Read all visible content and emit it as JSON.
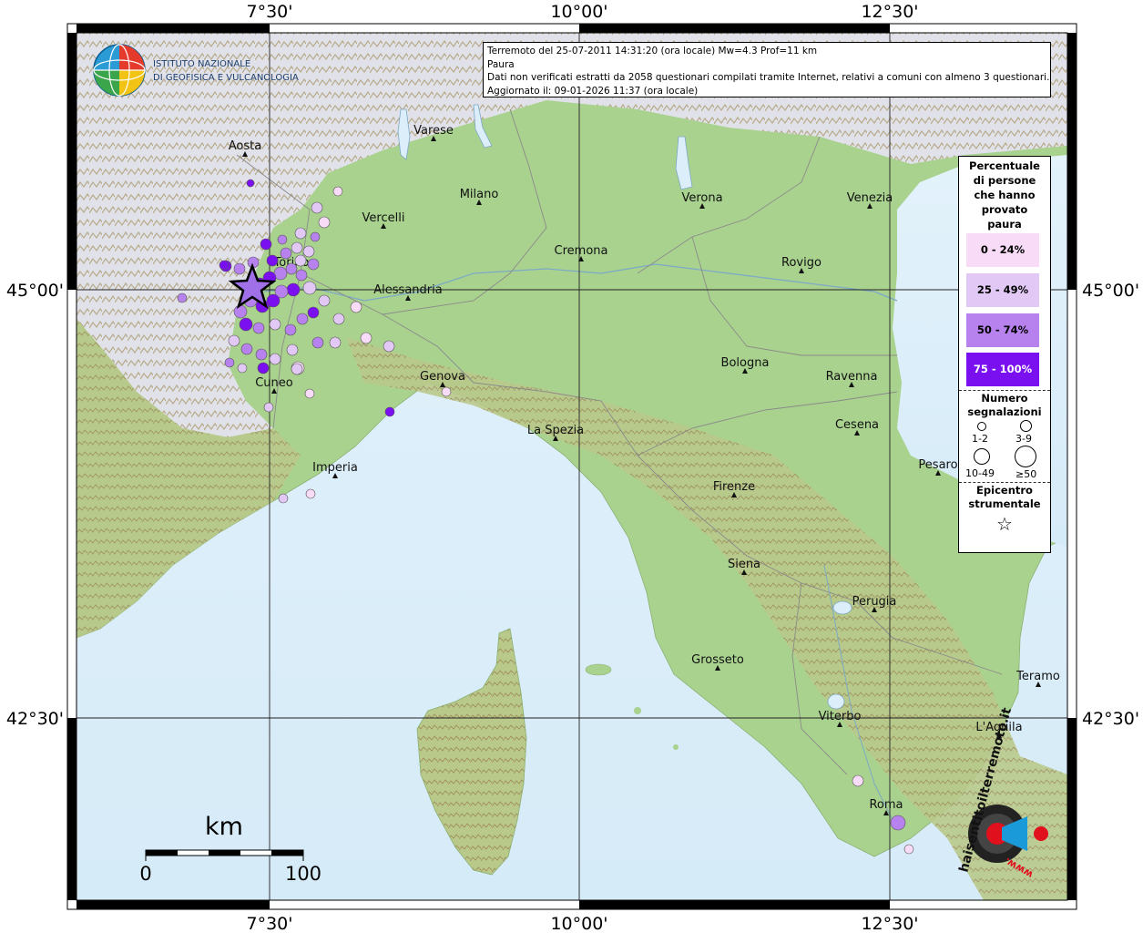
{
  "info": {
    "line1": "Terremoto del 25-07-2011 14:31:20 (ora locale) Mw=4.3 Prof=11 km",
    "line2": "Paura",
    "line3": "Dati non verificati estratti da 2058 questionari compilati tramite Internet, relativi a comuni con almeno 3 questionari.",
    "line4": "Aggiornato il: 09-01-2026 11:37 (ora locale)"
  },
  "ingv_logo": {
    "line1": "ISTITUTO NAZIONALE",
    "line2": "DI GEOFISICA E VULCANOLOGIA"
  },
  "graticule": {
    "lon_labels": [
      "7°30'",
      "10°00'",
      "12°30'"
    ],
    "lat_labels": [
      "45°00'",
      "42°30'"
    ]
  },
  "cities": [
    {
      "name": "Aosta"
    },
    {
      "name": "Varese"
    },
    {
      "name": "Milano"
    },
    {
      "name": "Verona"
    },
    {
      "name": "Venezia"
    },
    {
      "name": "Vercelli"
    },
    {
      "name": "Torino"
    },
    {
      "name": "Cremona"
    },
    {
      "name": "Rovigo"
    },
    {
      "name": "Alessandria"
    },
    {
      "name": "Bologna"
    },
    {
      "name": "Ravenna"
    },
    {
      "name": "Cuneo"
    },
    {
      "name": "Genova"
    },
    {
      "name": "La Spezia"
    },
    {
      "name": "Cesena"
    },
    {
      "name": "Imperia"
    },
    {
      "name": "Pesaro"
    },
    {
      "name": "Firenze"
    },
    {
      "name": "Siena"
    },
    {
      "name": "Perugia"
    },
    {
      "name": "Grosseto"
    },
    {
      "name": "Teramo"
    },
    {
      "name": "Viterbo"
    },
    {
      "name": "L'Aquila"
    },
    {
      "name": "Roma"
    }
  ],
  "legend": {
    "title": [
      "Percentuale",
      "di persone",
      "che hanno",
      "provato",
      "paura"
    ],
    "bins": [
      {
        "label": "0 - 24%",
        "color": "#f8dcf7",
        "text_color": "#000000"
      },
      {
        "label": "25 - 49%",
        "color": "#e2c9f5",
        "text_color": "#000000"
      },
      {
        "label": "50 - 74%",
        "color": "#b782ee",
        "text_color": "#000000"
      },
      {
        "label": "75 - 100%",
        "color": "#7a0ff0",
        "text_color": "#ffffff"
      }
    ],
    "count_title": [
      "Numero",
      "segnalazioni"
    ],
    "count_sizes": [
      "1-2",
      "3-9",
      "10-49",
      "≥50"
    ],
    "epicenter_title": [
      "Epicentro",
      "strumentale"
    ]
  },
  "scale_bar": {
    "unit": "km",
    "start": "0",
    "end": "100"
  },
  "watermark": {
    "text": "haisentitoilterremoto.it",
    "url": "www."
  },
  "colors": {
    "sea": "#dbeefa",
    "lowland": "#9fcf8a",
    "hills": "#c9c085",
    "mountains": "#d8d8e6",
    "frame": "#000000"
  }
}
